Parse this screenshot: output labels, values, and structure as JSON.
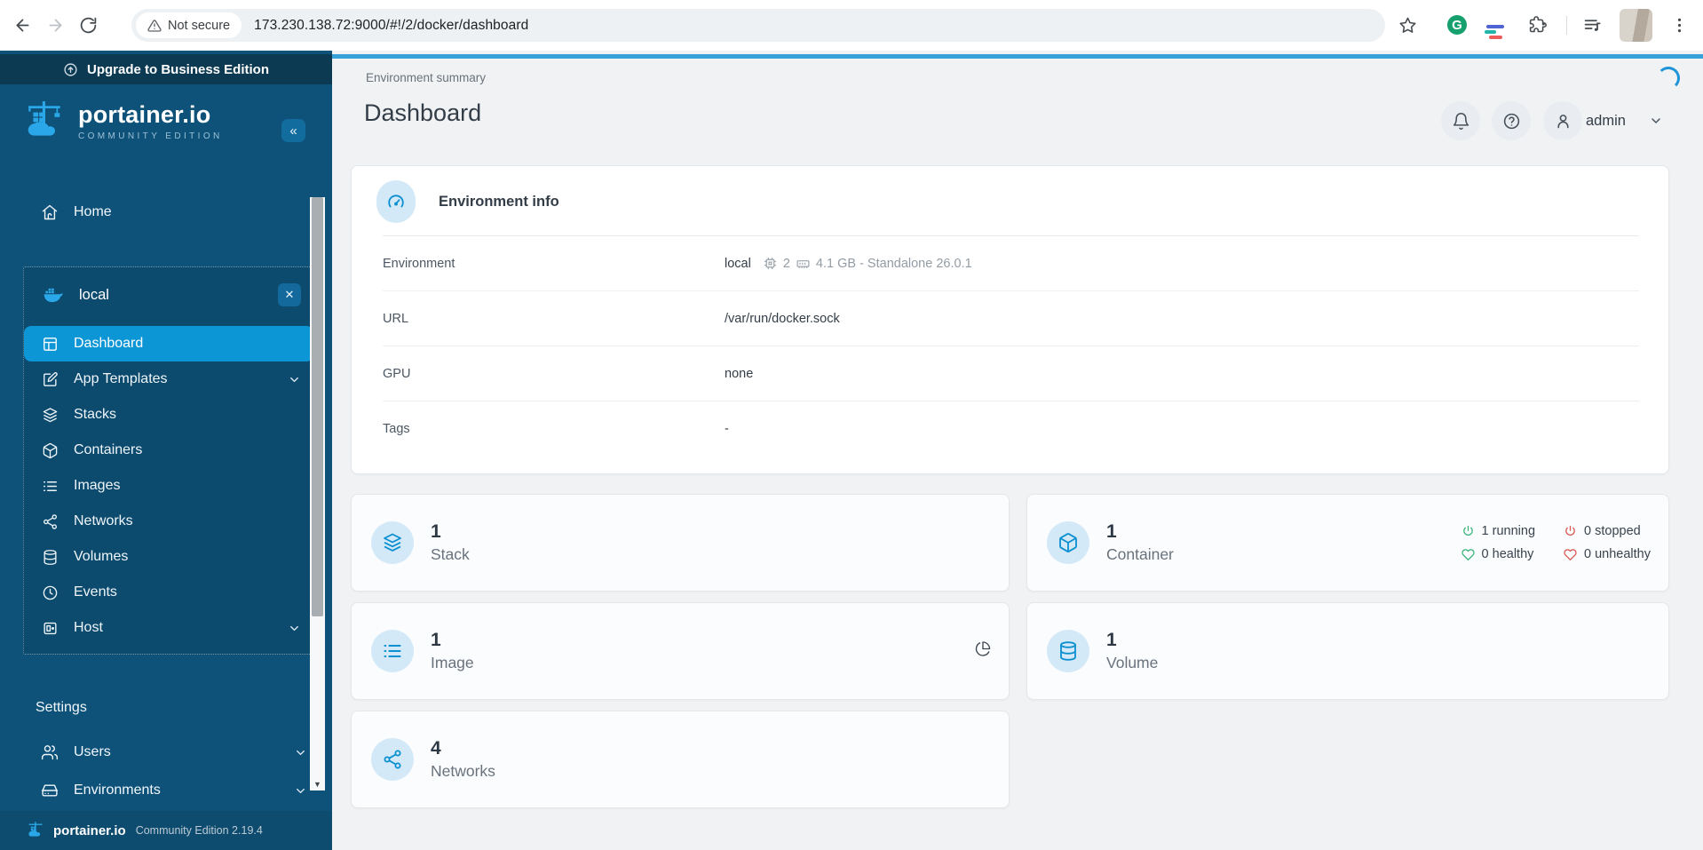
{
  "browser": {
    "not_secure": "Not secure",
    "url": "173.230.138.72:9000/#!/2/docker/dashboard"
  },
  "icons": {
    "collapse": "«",
    "close": "✕",
    "scroll_down_arrow": "▼",
    "grammarly_letter": "G"
  },
  "sidebar": {
    "upgrade": "Upgrade to Business Edition",
    "brand": "portainer.io",
    "brand_sub": "COMMUNITY EDITION",
    "home": "Home",
    "env_name": "local",
    "menu": [
      "Dashboard",
      "App Templates",
      "Stacks",
      "Containers",
      "Images",
      "Networks",
      "Volumes",
      "Events",
      "Host"
    ],
    "settings": "Settings",
    "users": "Users",
    "environments": "Environments",
    "footer_brand": "portainer.io",
    "footer_edition": "Community Edition 2.19.4"
  },
  "header": {
    "breadcrumb": "Environment summary",
    "title": "Dashboard",
    "user": "admin"
  },
  "env_info": {
    "title": "Environment info",
    "rows": {
      "environment": {
        "label": "Environment",
        "name": "local",
        "cpus": "2",
        "memory": "4.1 GB - Standalone 26.0.1"
      },
      "url": {
        "label": "URL",
        "value": "/var/run/docker.sock"
      },
      "gpu": {
        "label": "GPU",
        "value": "none"
      },
      "tags": {
        "label": "Tags",
        "value": "-"
      }
    }
  },
  "cards": {
    "stack": {
      "count": "1",
      "label": "Stack"
    },
    "container": {
      "count": "1",
      "label": "Container",
      "stats": [
        {
          "text": "1 running"
        },
        {
          "text": "0 stopped"
        },
        {
          "text": "0 healthy"
        },
        {
          "text": "0 unhealthy"
        }
      ]
    },
    "image": {
      "count": "1",
      "label": "Image"
    },
    "volume": {
      "count": "1",
      "label": "Volume"
    },
    "networks": {
      "count": "4",
      "label": "Networks"
    }
  },
  "colors": {
    "accent_blue": "#0d96d6",
    "sidebar_bg": "#0e527a",
    "banner_bg": "#0c3a52",
    "status_green": "#33b277",
    "status_red": "#d9534f"
  }
}
